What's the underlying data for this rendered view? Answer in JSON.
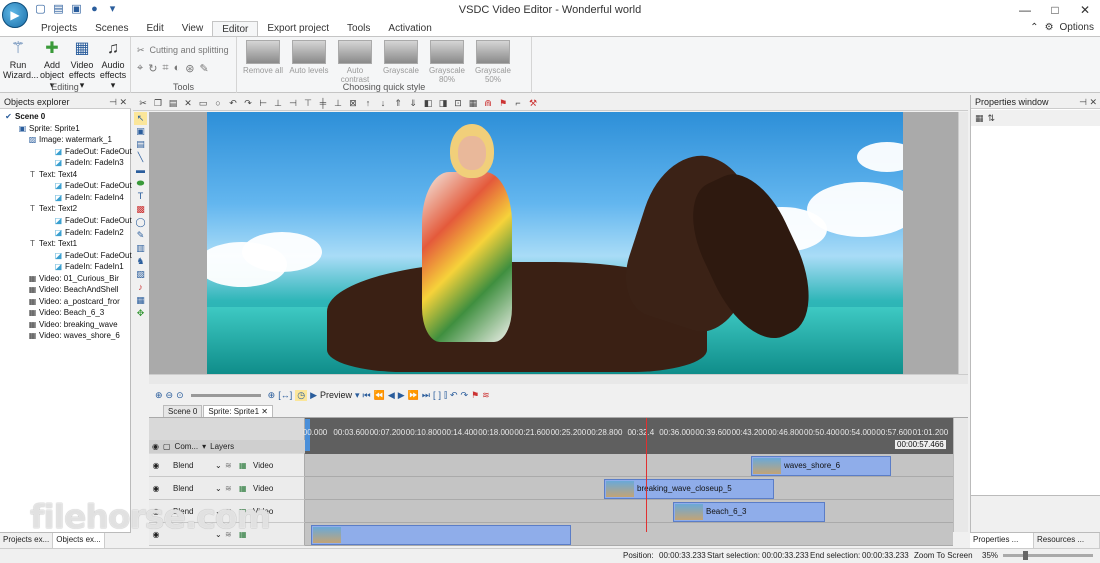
{
  "window": {
    "title": "VSDC Video Editor - Wonderful world",
    "controls": [
      "—",
      "□",
      "✕"
    ]
  },
  "menu": {
    "tabs": [
      "Projects",
      "Scenes",
      "Edit",
      "View",
      "Editor",
      "Export project",
      "Tools",
      "Activation"
    ],
    "active": "Editor",
    "options_label": "Options"
  },
  "ribbon": {
    "editing": {
      "label": "Editing",
      "buttons": [
        {
          "label": "Run Wizard...",
          "icon": "magic-wand-icon"
        },
        {
          "label": "Add object ▾",
          "icon": "add-object-icon"
        },
        {
          "label": "Video effects ▾",
          "icon": "film-icon"
        },
        {
          "label": "Audio effects ▾",
          "icon": "headphones-icon"
        }
      ]
    },
    "tools": {
      "label": "Tools",
      "cutting_label": "Cutting and splitting"
    },
    "quick_style": {
      "label": "Choosing quick style",
      "buttons": [
        "Remove all",
        "Auto levels",
        "Auto contrast",
        "Grayscale",
        "Grayscale 80%",
        "Grayscale 50%"
      ]
    }
  },
  "objects_explorer": {
    "title": "Objects explorer",
    "items": [
      {
        "label": "Scene 0",
        "level": 0,
        "icon": "scene-icon"
      },
      {
        "label": "Sprite: Sprite1",
        "level": 1,
        "icon": "sprite-icon"
      },
      {
        "label": "Image: watermark_1",
        "level": 2,
        "icon": "image-icon"
      },
      {
        "label": "FadeOut: FadeOut",
        "level": 3,
        "icon": "effect-icon"
      },
      {
        "label": "FadeIn: FadeIn3",
        "level": 3,
        "icon": "effect-icon"
      },
      {
        "label": "Text: Text4",
        "level": 2,
        "icon": "text-icon"
      },
      {
        "label": "FadeOut: FadeOut",
        "level": 3,
        "icon": "effect-icon"
      },
      {
        "label": "FadeIn: FadeIn4",
        "level": 3,
        "icon": "effect-icon"
      },
      {
        "label": "Text: Text2",
        "level": 2,
        "icon": "text-icon"
      },
      {
        "label": "FadeOut: FadeOut",
        "level": 3,
        "icon": "effect-icon"
      },
      {
        "label": "FadeIn: FadeIn2",
        "level": 3,
        "icon": "effect-icon"
      },
      {
        "label": "Text: Text1",
        "level": 2,
        "icon": "text-icon"
      },
      {
        "label": "FadeOut: FadeOut",
        "level": 3,
        "icon": "effect-icon"
      },
      {
        "label": "FadeIn: FadeIn1",
        "level": 3,
        "icon": "effect-icon"
      },
      {
        "label": "Video: 01_Curious_Bir",
        "level": 2,
        "icon": "video-icon"
      },
      {
        "label": "Video: BeachAndShell",
        "level": 2,
        "icon": "video-icon"
      },
      {
        "label": "Video: a_postcard_fror",
        "level": 2,
        "icon": "video-icon"
      },
      {
        "label": "Video: Beach_6_3",
        "level": 2,
        "icon": "video-icon"
      },
      {
        "label": "Video: breaking_wave",
        "level": 2,
        "icon": "video-icon"
      },
      {
        "label": "Video: waves_shore_6",
        "level": 2,
        "icon": "video-icon"
      }
    ],
    "bottom_tabs": [
      "Projects ex...",
      "Objects ex..."
    ]
  },
  "properties": {
    "title": "Properties window",
    "bottom_tabs": [
      "Properties ...",
      "Resources ..."
    ]
  },
  "timeline": {
    "preview_label": "Preview",
    "scene_tabs": [
      "Scene 0",
      "Sprite: Sprite1"
    ],
    "header": {
      "com": "Com...",
      "layers": "Layers"
    },
    "ruler_ticks": [
      "00.000",
      "00:03.600",
      "00:07.200",
      "00:10.800",
      "00:14.400",
      "00:18.000",
      "00:21.600",
      "00:25.200",
      "00:28.800",
      "00:32.4",
      "00:36.000",
      "00:39.600",
      "00:43.200",
      "00:46.800",
      "00:50.400",
      "00:54.000",
      "00:57.600",
      "01:01.200"
    ],
    "cursor_time": "00:00:57.466",
    "tracks": [
      {
        "blend": "Blend",
        "type": "Video",
        "clip": "waves_shore_6"
      },
      {
        "blend": "Blend",
        "type": "Video",
        "clip": "breaking_wave_closeup_5"
      },
      {
        "blend": "Blend",
        "type": "Video",
        "clip": "Beach_6_3"
      },
      {
        "blend": "",
        "type": "",
        "clip": ""
      }
    ]
  },
  "statusbar": {
    "position_label": "Position:",
    "position": "00:00:33.233",
    "start_label": "Start selection:",
    "start": "00:00:33.233",
    "end_label": "End selection:",
    "end": "00:00:33.233",
    "zoom_label": "Zoom To Screen",
    "zoom": "35%"
  },
  "watermark": "filehorse.com"
}
